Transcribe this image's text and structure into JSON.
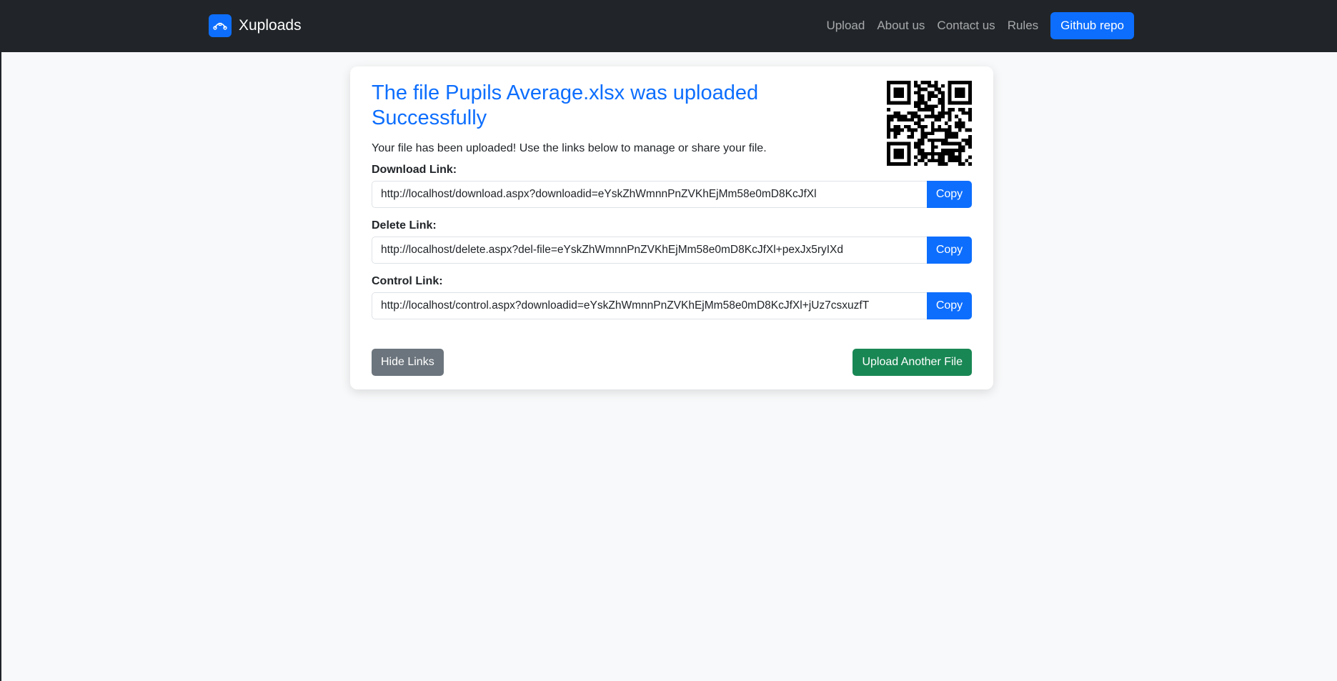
{
  "navbar": {
    "brand": "Xuploads",
    "brand_icon": "network-curve-icon",
    "links": [
      "Upload",
      "About us",
      "Contact us",
      "Rules"
    ],
    "github_button": "Github repo"
  },
  "card": {
    "title": "The file Pupils Average.xlsx was uploaded Successfully",
    "subtitle": "Your file has been uploaded! Use the links below to manage or share your file.",
    "qr_icon": "qr-code-icon",
    "fields": [
      {
        "label": "Download Link:",
        "value": "http://localhost/download.aspx?downloadid=eYskZhWmnnPnZVKhEjMm58e0mD8KcJfXl",
        "button": "Copy"
      },
      {
        "label": "Delete Link:",
        "value": "http://localhost/delete.aspx?del-file=eYskZhWmnnPnZVKhEjMm58e0mD8KcJfXl+pexJx5ryIXd",
        "button": "Copy"
      },
      {
        "label": "Control Link:",
        "value": "http://localhost/control.aspx?downloadid=eYskZhWmnnPnZVKhEjMm58e0mD8KcJfXl+jUz7csxuzfT",
        "button": "Copy"
      }
    ],
    "hide_button": "Hide Links",
    "upload_button": "Upload Another File"
  },
  "colors": {
    "navbar_bg": "#212529",
    "primary": "#0d6efd",
    "secondary": "#6c757d",
    "success": "#198754",
    "page_bg": "#f8f9fa"
  }
}
